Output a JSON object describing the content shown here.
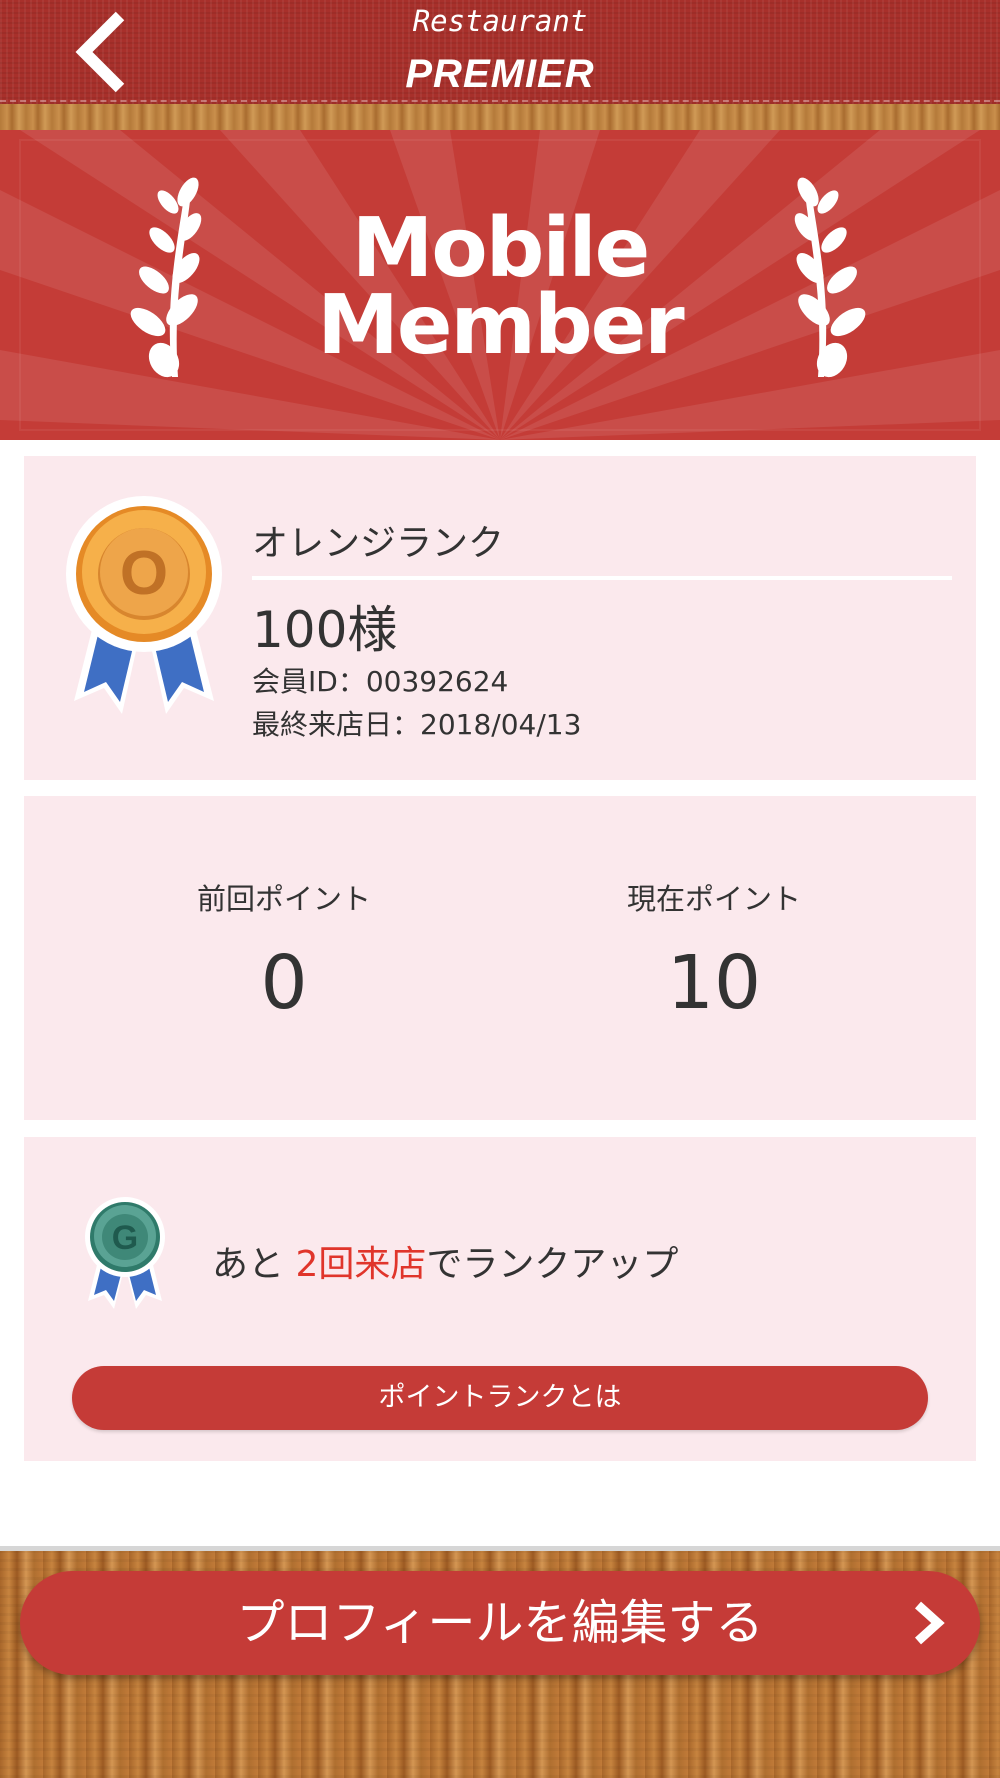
{
  "header": {
    "title_small": "Restaurant",
    "title_big": "PREMIER",
    "back_icon": "chevron-left-icon"
  },
  "banner": {
    "line1": "Mobile",
    "line2": "Member",
    "decoration": "laurel-branch-icon"
  },
  "member_card": {
    "rank_name": "オレンジランク",
    "member_name": "100様",
    "member_id": "会員ID：00392624",
    "last_visit": "最終来店日：2018/04/13",
    "medal_letter": "O",
    "medal_color": "#f0a43a",
    "ribbon_color": "#3f6fc4"
  },
  "points": {
    "previous_label": "前回ポイント",
    "previous_value": "0",
    "current_label": "現在ポイント",
    "current_value": "10"
  },
  "rankup": {
    "next_medal_letter": "G",
    "prefix": "あと ",
    "highlight": "2回来店",
    "suffix": "でランクアップ",
    "button_label": "ポイントランクとは",
    "highlight_color": "#e0352b"
  },
  "footer": {
    "edit_button_label": "プロフィールを編集する",
    "edit_button_icon": "chevron-right-icon"
  },
  "colors": {
    "primary_red": "#c53b37",
    "card_bg": "#fbe9ed"
  }
}
